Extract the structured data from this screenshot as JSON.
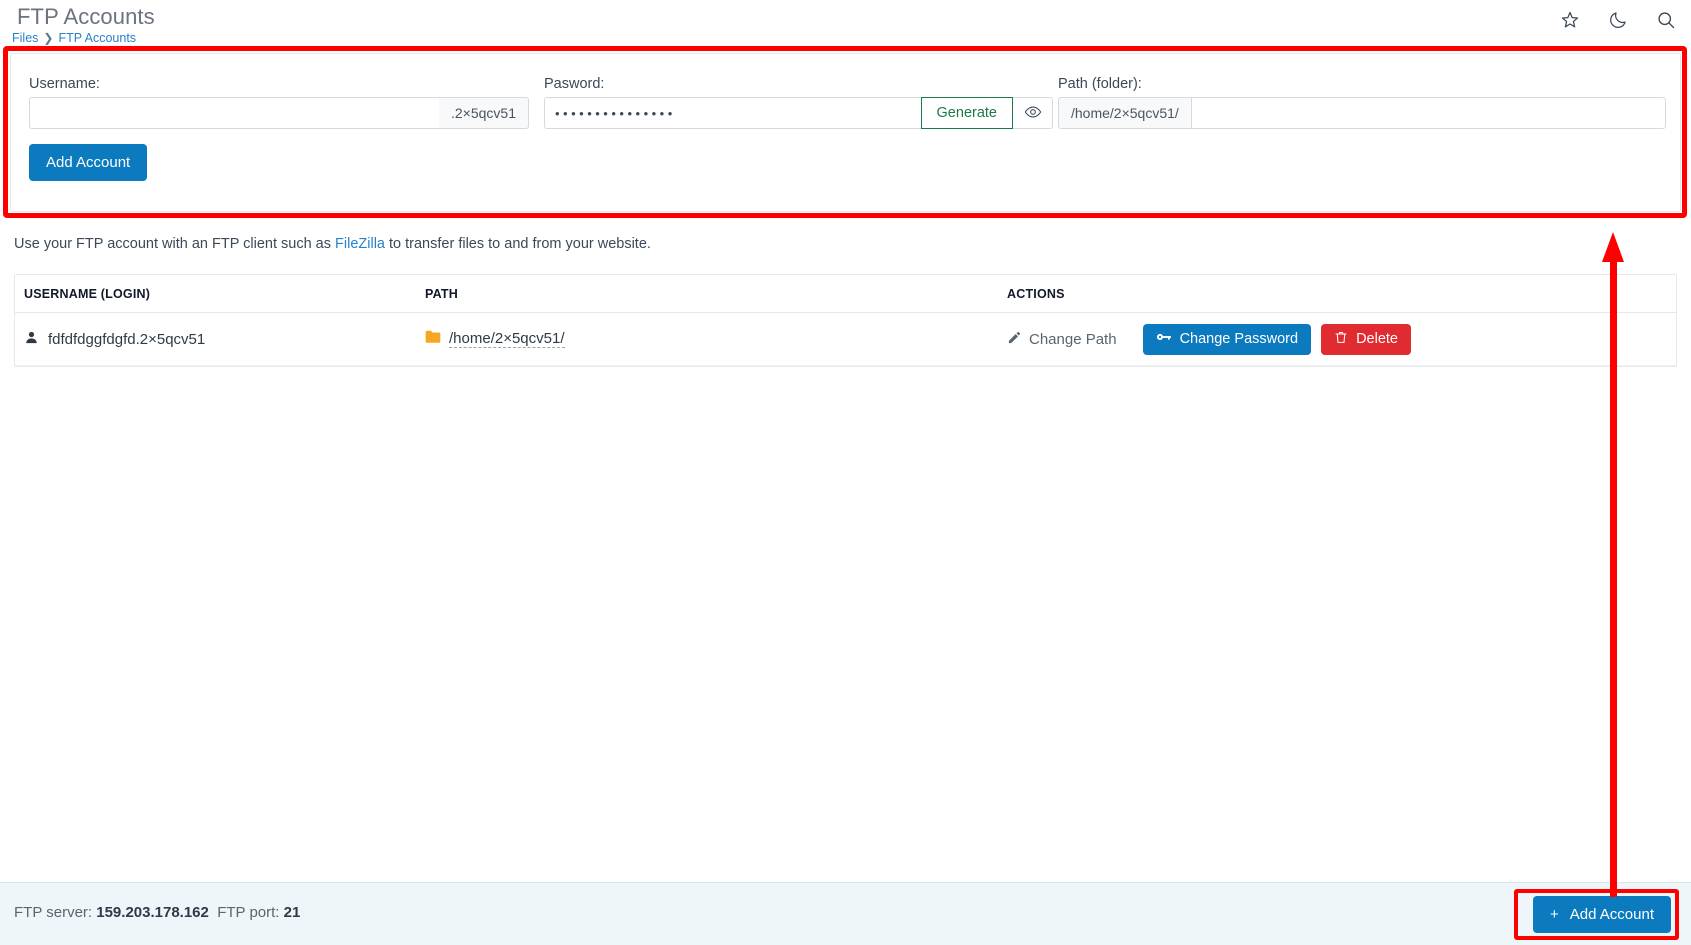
{
  "header": {
    "title": "FTP Accounts",
    "breadcrumb": {
      "parent": "Files",
      "separator": "❯",
      "current": "FTP Accounts"
    },
    "icons": [
      {
        "name": "favorite-icon",
        "glyph": "star"
      },
      {
        "name": "dark-mode-icon",
        "glyph": "moon"
      },
      {
        "name": "search-icon",
        "glyph": "magnifier"
      }
    ]
  },
  "form": {
    "username": {
      "label": "Username:",
      "value": "",
      "placeholder": "",
      "suffix": ".2×5qcv51"
    },
    "password": {
      "label": "Pasword:",
      "value": "•••••••••••••••",
      "generate_label": "Generate",
      "toggle_name": "eye-icon"
    },
    "path": {
      "label": "Path (folder):",
      "prefix": "/home/2×5qcv51/",
      "value": "",
      "placeholder": ""
    },
    "submit_label": "Add Account"
  },
  "helper": {
    "before": "Use your FTP account with an FTP client such as ",
    "link": "FileZilla",
    "after": " to transfer files to and from your website."
  },
  "table": {
    "columns": [
      "USERNAME (LOGIN)",
      "PATH",
      "ACTIONS"
    ],
    "rows": [
      {
        "username": "fdfdfdggfdgfd.2×5qcv51",
        "path": "/home/2×5qcv51/",
        "actions": {
          "change_path": "Change Path",
          "change_password": "Change Password",
          "delete": "Delete"
        }
      }
    ]
  },
  "footer": {
    "server_label": "FTP server:",
    "server_value": "159.203.178.162",
    "port_label": "FTP port:",
    "port_value": "21",
    "add_label": "Add Account",
    "add_plus": "+"
  },
  "colors": {
    "primary": "#0c7abf",
    "danger": "#e02b31",
    "success": "#1c7a46",
    "link": "#2a82c8",
    "annotation": "#ff0000",
    "folder": "#f5a623"
  }
}
